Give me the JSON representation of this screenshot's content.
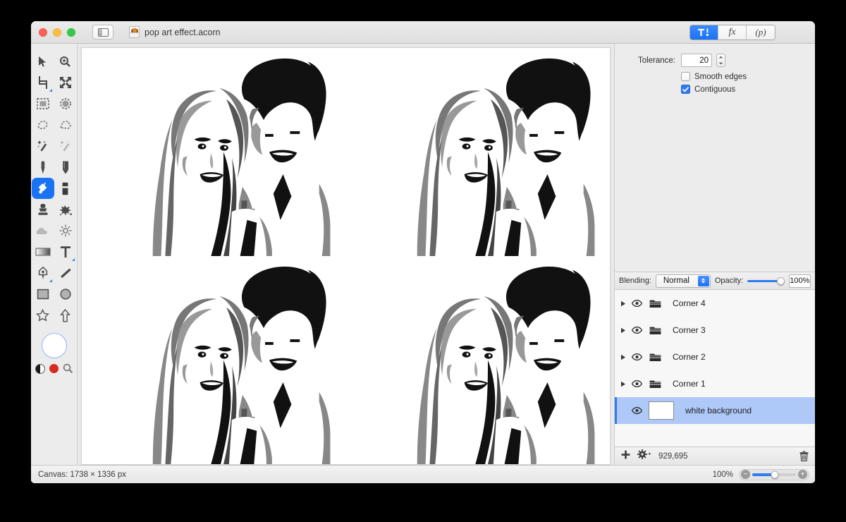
{
  "window": {
    "document_title": "pop art effect.acorn",
    "traffic_lights": [
      "close-button",
      "minimize-button",
      "maximize-button"
    ],
    "sidebar_toggle_icon": "sidebar-toggle-icon",
    "document_icon": "acorn-document-icon"
  },
  "segmented_control": {
    "items": [
      {
        "label": "",
        "icon": "tool-options-icon",
        "active": true
      },
      {
        "label": "fx",
        "icon": "filters-icon",
        "active": false
      },
      {
        "label": "(p)",
        "icon": "properties-icon",
        "active": false
      }
    ]
  },
  "toolbox": {
    "tools": [
      {
        "name": "move-tool",
        "icon": "arrow-cursor-icon"
      },
      {
        "name": "zoom-tool",
        "icon": "magnifier-plus-icon"
      },
      {
        "name": "crop-tool",
        "icon": "crop-icon"
      },
      {
        "name": "transform-tool",
        "icon": "move-arrows-icon"
      },
      {
        "name": "rectangle-select-tool",
        "icon": "marquee-rect-icon"
      },
      {
        "name": "ellipse-select-tool",
        "icon": "marquee-ellipse-icon"
      },
      {
        "name": "lasso-tool",
        "icon": "lasso-icon"
      },
      {
        "name": "polygon-lasso-tool",
        "icon": "polygon-lasso-icon"
      },
      {
        "name": "magic-wand-tool",
        "icon": "magic-wand-icon"
      },
      {
        "name": "instant-alpha-tool",
        "icon": "magic-wand-sparkle-icon"
      },
      {
        "name": "brush-tool",
        "icon": "brush-icon"
      },
      {
        "name": "pencil-tool",
        "icon": "pencil-icon"
      },
      {
        "name": "paint-bucket-tool",
        "icon": "paint-bucket-icon",
        "selected": true
      },
      {
        "name": "eraser-tool",
        "icon": "eraser-icon"
      },
      {
        "name": "clone-stamp-tool",
        "icon": "stamp-icon"
      },
      {
        "name": "smudge-tool",
        "icon": "splatter-icon"
      },
      {
        "name": "blur-tool",
        "icon": "cloud-icon"
      },
      {
        "name": "dodge-burn-tool",
        "icon": "sun-icon"
      },
      {
        "name": "gradient-tool",
        "icon": "gradient-icon"
      },
      {
        "name": "text-tool",
        "icon": "text-t-icon"
      },
      {
        "name": "bezier-tool",
        "icon": "pen-nib-icon"
      },
      {
        "name": "line-tool",
        "icon": "line-icon"
      },
      {
        "name": "rectangle-shape-tool",
        "icon": "rectangle-icon"
      },
      {
        "name": "ellipse-shape-tool",
        "icon": "circle-icon"
      },
      {
        "name": "star-shape-tool",
        "icon": "star-icon"
      },
      {
        "name": "arrow-shape-tool",
        "icon": "arrow-up-icon"
      }
    ],
    "color_well": {
      "name": "foreground-color-well",
      "color": "#ffffff"
    },
    "swatches": [
      {
        "name": "black-white-swatch-toggle",
        "icon": "half-circle-icon"
      },
      {
        "name": "red-color-swatch",
        "icon": "color-dot-icon",
        "color": "#d62b20"
      },
      {
        "name": "color-picker-tool",
        "icon": "magnifier-icon"
      }
    ]
  },
  "tool_options": {
    "tolerance_label": "Tolerance:",
    "tolerance_value": "20",
    "stepper_name": "tolerance-stepper",
    "checkboxes": [
      {
        "label": "Smooth edges",
        "checked": false
      },
      {
        "label": "Contiguous",
        "checked": true
      }
    ]
  },
  "layers_panel": {
    "blending_label": "Blending:",
    "blending_value": "Normal",
    "opacity_label": "Opacity:",
    "opacity_value": "100%",
    "opacity_percent": 100,
    "layers": [
      {
        "name": "Corner 4",
        "type": "group",
        "visible": true,
        "expanded": false,
        "selected": false
      },
      {
        "name": "Corner 3",
        "type": "group",
        "visible": true,
        "expanded": false,
        "selected": false
      },
      {
        "name": "Corner 2",
        "type": "group",
        "visible": true,
        "expanded": false,
        "selected": false
      },
      {
        "name": "Corner 1",
        "type": "group",
        "visible": true,
        "expanded": false,
        "selected": false
      },
      {
        "name": "white background",
        "type": "bitmap",
        "visible": true,
        "selected": true,
        "thumbnail_color": "#ffffff"
      }
    ],
    "toolbar": {
      "add_label": "+",
      "add_name": "add-layer-button",
      "settings_name": "layer-settings-button",
      "count": "929,695",
      "trash_name": "delete-layer-button"
    }
  },
  "status_bar": {
    "canvas_label": "Canvas: 1738 × 1336 px",
    "zoom_label": "100%",
    "zoom_percent": 100,
    "zoom_out_glyph": "−",
    "zoom_in_glyph": "+"
  },
  "canvas": {
    "description": "2x2 grid of posterized black-and-white pop-art portraits of a couple",
    "cells": 4,
    "background": "#ffffff"
  },
  "colors": {
    "accent": "#1a72f5",
    "selection": "#aec8f7",
    "panel_bg": "#ececec",
    "list_bg": "#f7f7f7",
    "window_bg": "#e9e9e9"
  }
}
